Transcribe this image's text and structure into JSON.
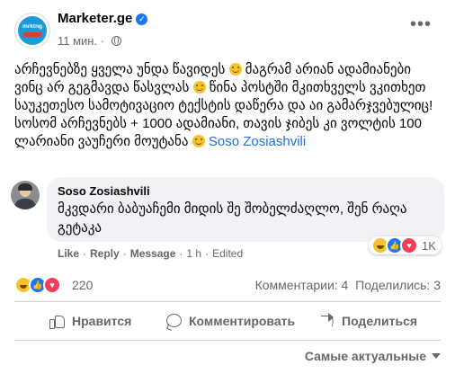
{
  "post": {
    "page_name": "Marketer.ge",
    "avatar_text": "mrktng",
    "verified": true,
    "time": "11 мин.",
    "separator": "·",
    "text_part1": "არჩევნებზე ყველა უნდა წავიდეს",
    "text_part2": "მაგრამ არიან ადამიანები ვინც არ გეგმავდა წასვლას",
    "text_part3": "წინა პოსტში მკითხველს ვკითხეთ საუკეთესო სამოტივაციო ტექსტის დაწერა და აი გამარჯვებულიც! სოსომ არჩევნებს + 1000 ადამიანი, თავის ჯიბეს კი ვოლტის 100 ლარიანი ვაუჩერი მოუტანა",
    "mention": "Soso Zosiashvili"
  },
  "comment": {
    "author": "Soso Zosiashvili",
    "text": "მკვდარი ბაბუაჩემი მიდის შე შობელძაღლო, შენ რაღა გეტაკა",
    "reaction_count": "1K",
    "actions": {
      "like": "Like",
      "reply": "Reply",
      "message": "Message",
      "time": "1 h",
      "edited": "Edited"
    }
  },
  "summary": {
    "reaction_count": "220",
    "comments": "Комментарии: 4",
    "shares": "Поделились: 3"
  },
  "buttons": {
    "like": "Нравится",
    "comment": "Комментировать",
    "share": "Поделиться"
  },
  "sort_label": "Самые актуальные",
  "icons": [
    "verified-icon",
    "globe-icon",
    "more-icon",
    "smile-emoji-icon",
    "haha-reaction-icon",
    "like-reaction-icon",
    "love-reaction-icon",
    "like-icon",
    "comment-icon",
    "share-icon",
    "caret-down-icon"
  ],
  "colors": {
    "accent": "#1877f2",
    "mention": "#216fdb",
    "secondary_text": "#65676b",
    "bubble": "#f0f2f5",
    "love": "#f33e58",
    "haha": "#f7c32c"
  }
}
